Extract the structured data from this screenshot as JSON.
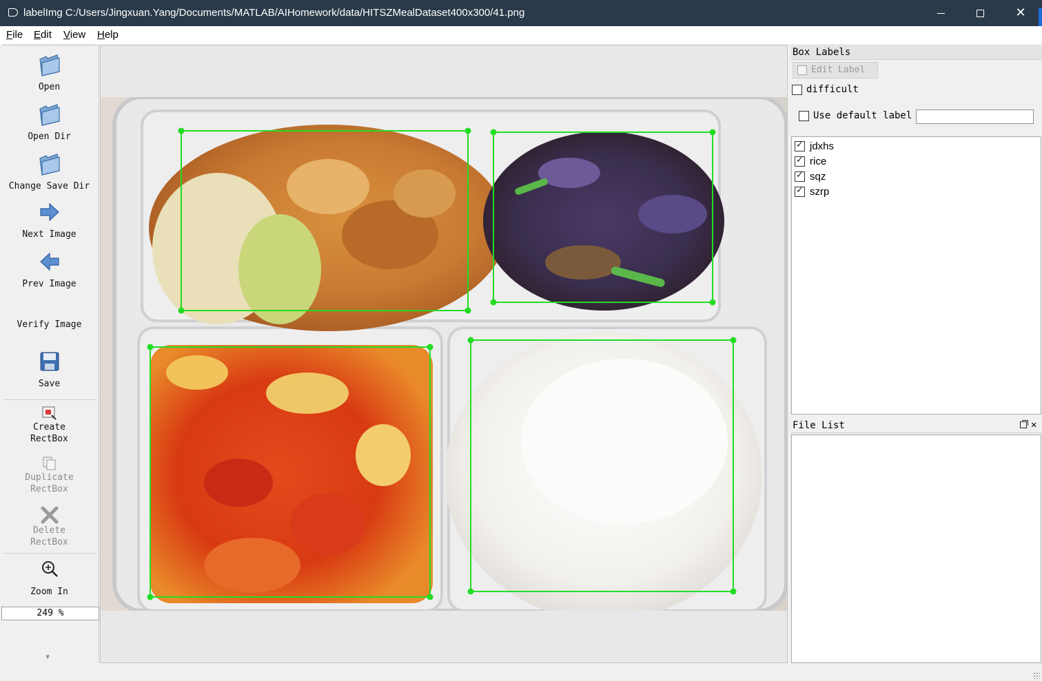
{
  "window": {
    "title": "labelImg C:/Users/Jingxuan.Yang/Documents/MATLAB/AIHomework/data/HITSZMealDataset400x300/41.png",
    "minimize_glyph": "—",
    "maximize_glyph": "☐",
    "close_glyph": "✕"
  },
  "menu": {
    "file": {
      "underline": "F",
      "rest": "ile"
    },
    "edit": {
      "underline": "E",
      "rest": "dit"
    },
    "view": {
      "underline": "V",
      "rest": "iew"
    },
    "help": {
      "underline": "H",
      "rest": "elp"
    }
  },
  "toolbar": {
    "open": {
      "label": "Open",
      "icon": "folder-icon"
    },
    "open_dir": {
      "label": "Open Dir",
      "icon": "folder-icon"
    },
    "change_save_dir": {
      "label": "Change Save Dir",
      "icon": "folder-icon"
    },
    "next_image": {
      "label": "Next Image",
      "icon": "arrow-right-icon"
    },
    "prev_image": {
      "label": "Prev Image",
      "icon": "arrow-left-icon"
    },
    "verify_image": {
      "label": "Verify Image"
    },
    "save": {
      "label": "Save",
      "icon": "floppy-disk-icon"
    },
    "create_rectbox": {
      "label1": "Create",
      "label2": "RectBox",
      "icon": "create-rect-icon"
    },
    "duplicate_rectbox": {
      "label1": "Duplicate",
      "label2": "RectBox",
      "icon": "duplicate-icon"
    },
    "delete_rectbox": {
      "label1": "Delete",
      "label2": "RectBox",
      "icon": "delete-x-icon"
    },
    "zoom_in": {
      "label": "Zoom In",
      "icon": "zoom-in-icon"
    },
    "zoom_value": "249 %",
    "more": "»"
  },
  "canvas": {
    "box_color": "#22dd22",
    "boxes": [
      "jdxhs",
      "sqz",
      "szrp",
      "rice"
    ]
  },
  "box_labels_panel": {
    "title": "Box Labels",
    "edit_label": "Edit Label",
    "difficult": "difficult",
    "use_default_label": "Use default label",
    "default_label_value": "",
    "labels": [
      {
        "text": "jdxhs",
        "checked": true
      },
      {
        "text": "rice",
        "checked": true
      },
      {
        "text": "sqz",
        "checked": true
      },
      {
        "text": "szrp",
        "checked": true
      }
    ]
  },
  "file_list_panel": {
    "title": "File List",
    "files": []
  }
}
